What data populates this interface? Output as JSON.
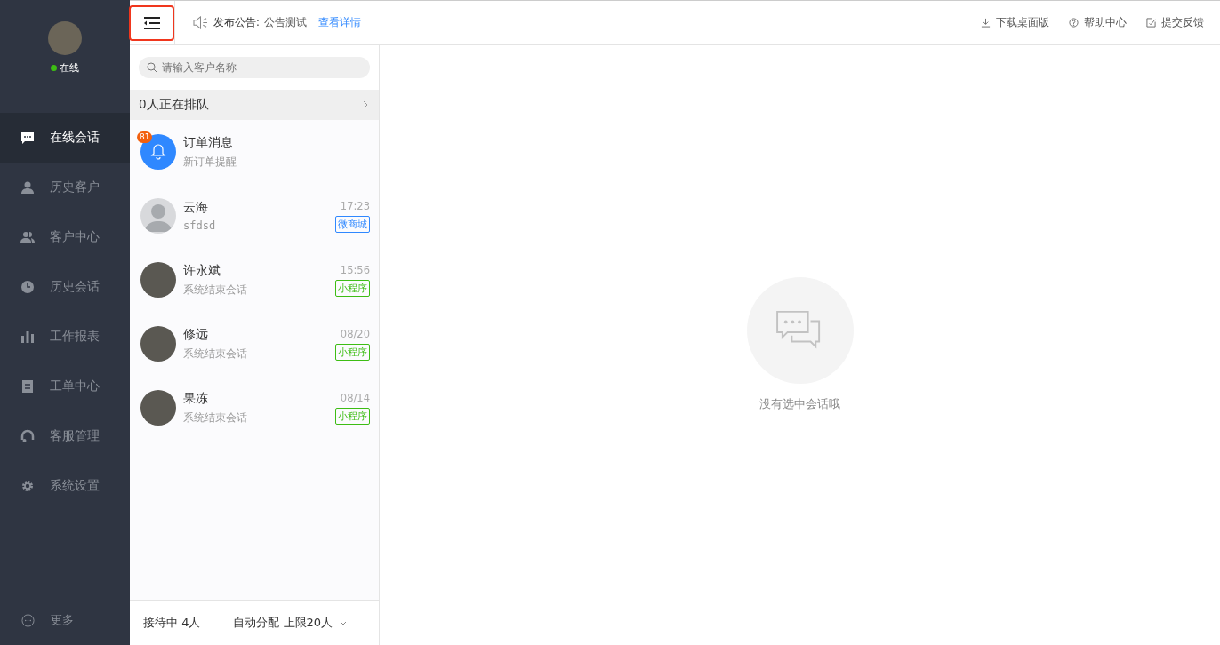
{
  "sidebar": {
    "status": {
      "label": "在线",
      "online": true
    },
    "items": [
      {
        "label": "在线会话",
        "selected": true
      },
      {
        "label": "历史客户",
        "selected": false
      },
      {
        "label": "客户中心",
        "selected": false
      },
      {
        "label": "历史会话",
        "selected": false
      },
      {
        "label": "工作报表",
        "selected": false
      },
      {
        "label": "工单中心",
        "selected": false
      },
      {
        "label": "客服管理",
        "selected": false
      },
      {
        "label": "系统设置",
        "selected": false
      }
    ],
    "more": "更多"
  },
  "topbar": {
    "announcement_label": "发布公告:",
    "announcement_text": "公告测试",
    "announcement_link": "查看详情",
    "actions": [
      "下载桌面版",
      "帮助中心",
      "提交反馈"
    ]
  },
  "conversations": {
    "search": {
      "placeholder": "请输入客户名称"
    },
    "queue": "0人正在排队",
    "items": [
      {
        "kind": "notice",
        "name": "订单消息",
        "preview": "新订单提醒",
        "badge": "81"
      },
      {
        "kind": "default",
        "name": "云海",
        "preview": "sfdsd",
        "time": "17:23",
        "tag": "微商城",
        "color": "#2f88ff"
      },
      {
        "kind": "photo",
        "name": "许永斌",
        "preview": "系统结束会话",
        "time": "15:56",
        "tag": "小程序",
        "color": "#3dbd14"
      },
      {
        "kind": "photo",
        "name": "修远",
        "preview": "系统结束会话",
        "time": "08/20",
        "tag": "小程序",
        "color": "#3dbd14"
      },
      {
        "kind": "photo",
        "name": "果冻",
        "preview": "系统结束会话",
        "time": "08/14",
        "tag": "小程序",
        "color": "#3dbd14"
      }
    ],
    "footer": {
      "serving": "接待中 4人",
      "assign": "自动分配 上限20人"
    }
  },
  "empty": {
    "message": "没有选中会话哦"
  }
}
